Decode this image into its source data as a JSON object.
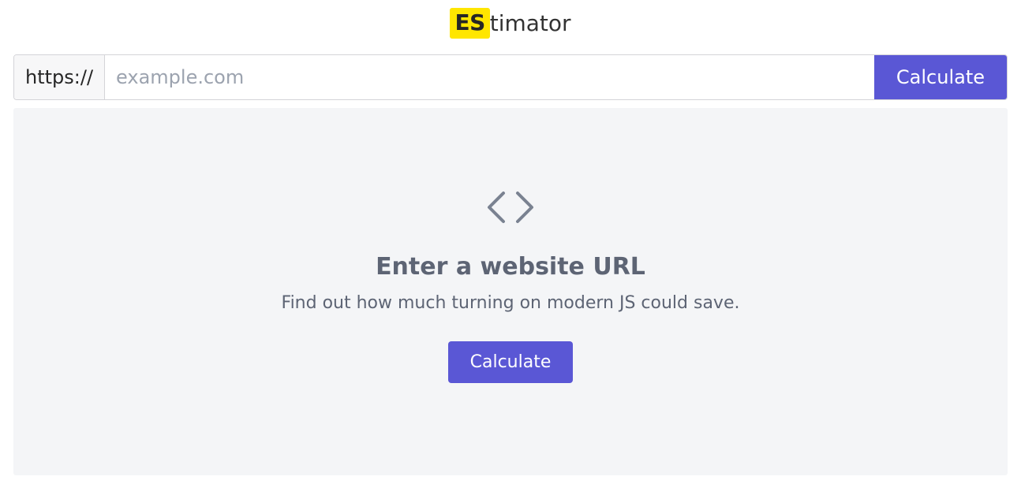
{
  "logo": {
    "badge": "ES",
    "rest": "timator"
  },
  "urlbar": {
    "prefix": "https://",
    "placeholder": "example.com",
    "value": "",
    "button": "Calculate"
  },
  "card": {
    "heading": "Enter a website URL",
    "subtext": "Find out how much turning on modern JS could save.",
    "button": "Calculate"
  }
}
